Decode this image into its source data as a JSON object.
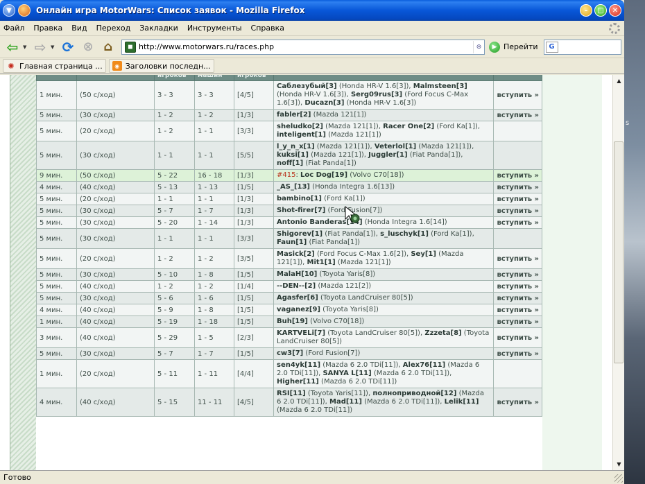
{
  "window": {
    "title": "Онлайн игра MotorWars: Список заявок - Mozilla Firefox"
  },
  "menu": {
    "items": [
      "Файл",
      "Правка",
      "Вид",
      "Переход",
      "Закладки",
      "Инструменты",
      "Справка"
    ]
  },
  "nav": {
    "url": "http://www.motorwars.ru/races.php",
    "go_label": "Перейти"
  },
  "bookmarks": {
    "items": [
      {
        "label": "Главная страница ...",
        "icon": "firefox-icon"
      },
      {
        "label": "Заголовки последн...",
        "icon": "rss-icon"
      }
    ]
  },
  "table": {
    "headers": [
      "",
      "",
      "игроков",
      "машин",
      "игроков",
      "",
      ""
    ],
    "rows": [
      {
        "time": "1 мин.",
        "rate": "(50 с/ход)",
        "players_range": "3 - 3",
        "cars_range": "3 - 3",
        "count": "[4/5]",
        "participants": "<b>Саблезубый[3]</b> (Honda HR-V 1.6[3]), <b>Malmsteen[3]</b> (Honda HR-V 1.6[3]), <b>Serg09rus[3]</b> (Ford Focus C-Max 1.6[3]), <b>Ducazn[3]</b> (Honda HR-V 1.6[3])",
        "action": "вступить »"
      },
      {
        "time": "5 мин.",
        "rate": "(30 с/ход)",
        "players_range": "1 - 2",
        "cars_range": "1 - 2",
        "count": "[1/3]",
        "participants": "<b>fabler[2]</b> (Mazda 121[1])",
        "action": "вступить »"
      },
      {
        "time": "5 мин.",
        "rate": "(20 с/ход)",
        "players_range": "1 - 2",
        "cars_range": "1 - 1",
        "count": "[3/3]",
        "participants": "<b>sheludko[2]</b> (Mazda 121[1]), <b>Racer One[2]</b> (Ford Ka[1]), <b>inteligent[1]</b> (Mazda 121[1])",
        "action": ""
      },
      {
        "time": "5 мин.",
        "rate": "(30 с/ход)",
        "players_range": "1 - 1",
        "cars_range": "1 - 1",
        "count": "[5/5]",
        "participants": "<b>l_y_n_x[1]</b> (Mazda 121[1]), <b>Veterlol[1]</b> (Mazda 121[1]), <b>kuksi[1]</b> (Mazda 121[1]), <b>Juggler[1]</b> (Fiat Panda[1]), <b>noff[1]</b> (Fiat Panda[1])",
        "action": ""
      },
      {
        "time": "9 мин.",
        "rate": "(50 с/ход)",
        "players_range": "5 - 22",
        "cars_range": "16 - 18",
        "count": "[1/3]",
        "participants": "<span class=\"race-id\">#415</span>: <b>Loc Dog[19]</b> (Volvo C70[18])",
        "action": "вступить »",
        "highlight": true
      },
      {
        "time": "4 мин.",
        "rate": "(40 с/ход)",
        "players_range": "5 - 13",
        "cars_range": "1 - 13",
        "count": "[1/5]",
        "participants": "<b>_AS_[13]</b> (Honda Integra 1.6[13])",
        "action": "вступить »"
      },
      {
        "time": "5 мин.",
        "rate": "(20 с/ход)",
        "players_range": "1 - 1",
        "cars_range": "1 - 1",
        "count": "[1/3]",
        "participants": "<b>bambino[1]</b> (Ford Ka[1])",
        "action": "вступить »"
      },
      {
        "time": "5 мин.",
        "rate": "(30 с/ход)",
        "players_range": "5 - 7",
        "cars_range": "1 - 7",
        "count": "[1/3]",
        "participants": "<b>Shot-firer[7]</b> (Ford Fusion[7])",
        "action": "вступить »"
      },
      {
        "time": "5 мин.",
        "rate": "(30 с/ход)",
        "players_range": "5 - 20",
        "cars_range": "1 - 14",
        "count": "[1/3]",
        "participants": "<b>Antonio Banderas[14]</b> (Honda Integra 1.6[14])",
        "action": "вступить »"
      },
      {
        "time": "5 мин.",
        "rate": "(30 с/ход)",
        "players_range": "1 - 1",
        "cars_range": "1 - 1",
        "count": "[3/3]",
        "participants": "<b>Shigorev[1]</b> (Fiat Panda[1]), <b>s_luschyk[1]</b> (Ford Ka[1]), <b>Faun[1]</b> (Fiat Panda[1])",
        "action": ""
      },
      {
        "time": "5 мин.",
        "rate": "(20 с/ход)",
        "players_range": "1 - 2",
        "cars_range": "1 - 2",
        "count": "[3/5]",
        "participants": "<b>Masick[2]</b> (Ford Focus C-Max 1.6[2]), <b>Sey[1]</b> (Mazda 121[1]), <b>Mit1[1]</b> (Mazda 121[1])",
        "action": "вступить »"
      },
      {
        "time": "5 мин.",
        "rate": "(30 с/ход)",
        "players_range": "5 - 10",
        "cars_range": "1 - 8",
        "count": "[1/5]",
        "participants": "<b>MalaH[10]</b> (Toyota Yaris[8])",
        "action": "вступить »"
      },
      {
        "time": "5 мин.",
        "rate": "(40 с/ход)",
        "players_range": "1 - 2",
        "cars_range": "1 - 2",
        "count": "[1/4]",
        "participants": "<b>--DEN--[2]</b> (Mazda 121[2])",
        "action": "вступить »"
      },
      {
        "time": "5 мин.",
        "rate": "(30 с/ход)",
        "players_range": "5 - 6",
        "cars_range": "1 - 6",
        "count": "[1/5]",
        "participants": "<b>Agasfer[6]</b> (Toyota LandCruiser 80[5])",
        "action": "вступить »"
      },
      {
        "time": "4 мин.",
        "rate": "(40 с/ход)",
        "players_range": "5 - 9",
        "cars_range": "1 - 8",
        "count": "[1/5]",
        "participants": "<b>vaganez[9]</b> (Toyota Yaris[8])",
        "action": "вступить »"
      },
      {
        "time": "1 мин.",
        "rate": "(40 с/ход)",
        "players_range": "5 - 19",
        "cars_range": "1 - 18",
        "count": "[1/5]",
        "participants": "<b>Buh[19]</b> (Volvo C70[18])",
        "action": "вступить »"
      },
      {
        "time": "3 мин.",
        "rate": "(40 с/ход)",
        "players_range": "5 - 29",
        "cars_range": "1 - 5",
        "count": "[2/3]",
        "participants": "<b>KARTVELi[7]</b> (Toyota LandCruiser 80[5]), <b>Zzzeta[8]</b> (Toyota LandCruiser 80[5])",
        "action": "вступить »"
      },
      {
        "time": "5 мин.",
        "rate": "(30 с/ход)",
        "players_range": "5 - 7",
        "cars_range": "1 - 7",
        "count": "[1/5]",
        "participants": "<b>cw3[7]</b> (Ford Fusion[7])",
        "action": "вступить »"
      },
      {
        "time": "1 мин.",
        "rate": "(20 с/ход)",
        "players_range": "5 - 11",
        "cars_range": "1 - 11",
        "count": "[4/4]",
        "participants": "<b>sen4yk[11]</b> (Mazda 6 2.0 TDi[11]), <b>Alex76[11]</b> (Mazda 6 2.0 TDi[11]), <b>SANYA L[11]</b> (Mazda 6 2.0 TDi[11]), <b>Higher[11]</b> (Mazda 6 2.0 TDi[11])",
        "action": ""
      },
      {
        "time": "4 мин.",
        "rate": "(40 с/ход)",
        "players_range": "5 - 15",
        "cars_range": "11 - 11",
        "count": "[4/5]",
        "participants": "<b>RSI[11]</b> (Toyota Yaris[11]), <b>полноприводной[12]</b> (Mazda 6 2.0 TDi[11]), <b>Mad[11]</b> (Mazda 6 2.0 TDi[11]), <b>Lelik[11]</b> (Mazda 6 2.0 TDi[11])",
        "action": "вступить »"
      }
    ]
  },
  "status": {
    "text": "Готово"
  }
}
